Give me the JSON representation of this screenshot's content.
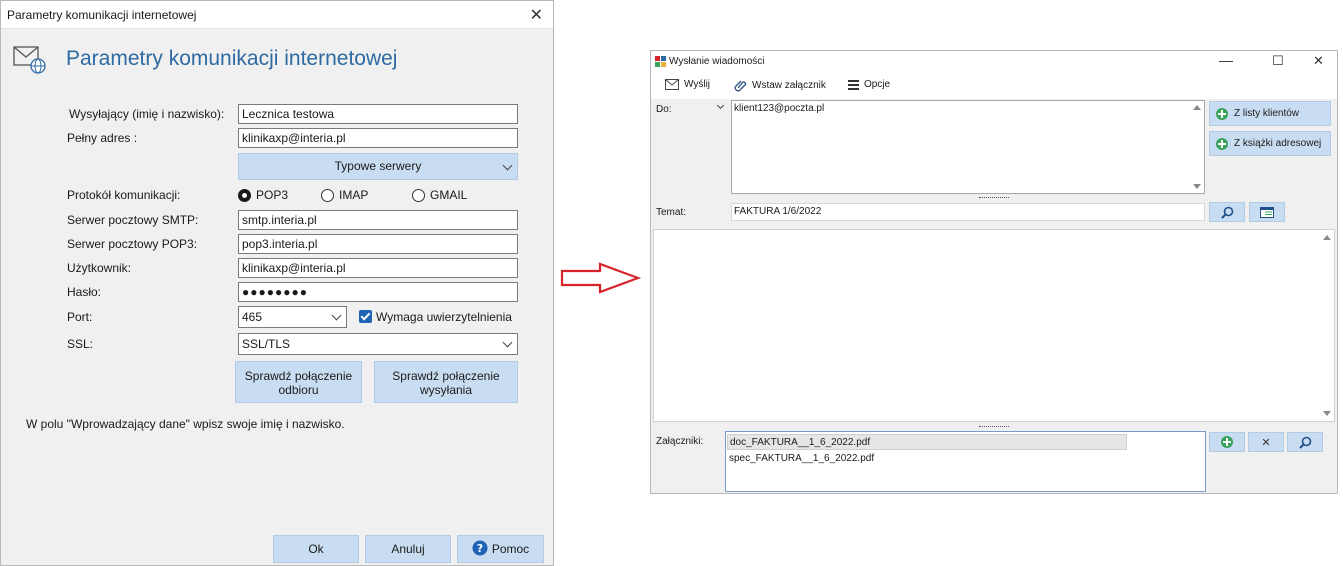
{
  "left": {
    "window_title": "Parametry komunikacji internetowej",
    "header_title": "Parametry komunikacji internetowej",
    "fields": {
      "sender_label": "Wysyłający (imię i nazwisko):",
      "sender_value": "Lecznica testowa",
      "address_label": "Pełny adres :",
      "address_value": "klinikaxp@interia.pl",
      "typical_servers": "Typowe serwery",
      "protocol_label": "Protokół komunikacji:",
      "protocol_options": [
        "POP3",
        "IMAP",
        "GMAIL"
      ],
      "protocol_selected": "POP3",
      "smtp_label": "Serwer pocztowy SMTP:",
      "smtp_value": "smtp.interia.pl",
      "pop3_label": "Serwer pocztowy POP3:",
      "pop3_value": "pop3.interia.pl",
      "user_label": "Użytkownik:",
      "user_value": "klinikaxp@interia.pl",
      "password_label": "Hasło:",
      "password_value": "●●●●●●●●",
      "port_label": "Port:",
      "port_value": "465",
      "auth_label": "Wymaga uwierzytelnienia",
      "auth_checked": true,
      "ssl_label": "SSL:",
      "ssl_value": "SSL/TLS"
    },
    "check_receive_1": "Sprawdź połączenie",
    "check_receive_2": "odbioru",
    "check_send_1": "Sprawdź połączenie",
    "check_send_2": "wysyłania",
    "info_text": "W polu \"Wprowadzający dane\" wpisz swoje imię i nazwisko.",
    "footer": {
      "ok": "Ok",
      "cancel": "Anuluj",
      "help": "Pomoc"
    }
  },
  "right": {
    "window_title": "Wysłanie wiadomości",
    "toolbar": {
      "send": "Wyślij",
      "attach": "Wstaw załącznik",
      "options": "Opcje"
    },
    "to_label": "Do:",
    "to_value": "klient123@poczta.pl",
    "from_clients": "Z listy klientów",
    "from_addressbook": "Z książki adresowej",
    "subject_label": "Temat:",
    "subject_value": "FAKTURA 1/6/2022",
    "attachments_label": "Załączniki:",
    "attachments": [
      "doc_FAKTURA__1_6_2022.pdf",
      "spec_FAKTURA__1_6_2022.pdf"
    ]
  },
  "colors": {
    "accent": "#2d6aa3",
    "button": "#c9ddf2",
    "arrow": "#d9232a"
  }
}
